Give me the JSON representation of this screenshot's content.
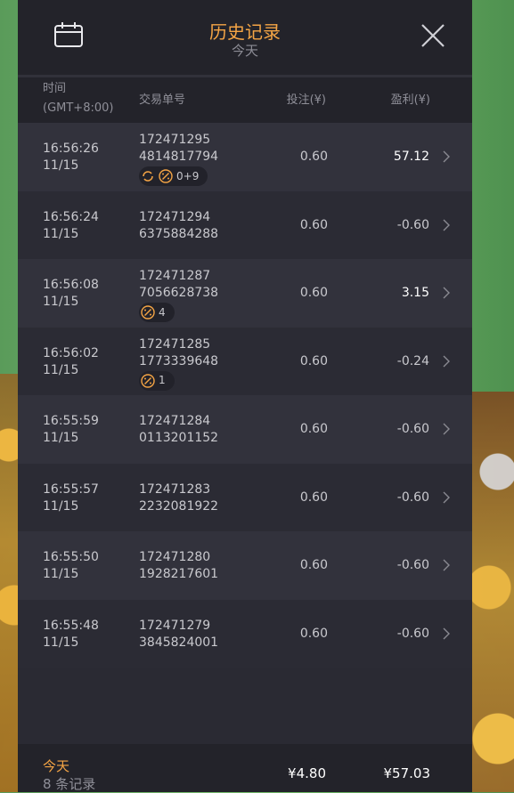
{
  "header": {
    "title": "历史记录",
    "subtitle": "今天"
  },
  "columns": {
    "time_line1": "时间",
    "time_line2": "(GMT+8:00)",
    "id": "交易单号",
    "bet": "投注(¥)",
    "profit": "盈利(¥)"
  },
  "rows": [
    {
      "time": "16:56:26",
      "date": "11/15",
      "id1": "172471295",
      "id2": "4814817794",
      "bet": "0.60",
      "profit": "57.12",
      "badge": "0+9",
      "badge_icons": [
        "spin-icon",
        "multiplier-icon"
      ]
    },
    {
      "time": "16:56:24",
      "date": "11/15",
      "id1": "172471294",
      "id2": "6375884288",
      "bet": "0.60",
      "profit": "-0.60"
    },
    {
      "time": "16:56:08",
      "date": "11/15",
      "id1": "172471287",
      "id2": "7056628738",
      "bet": "0.60",
      "profit": "3.15",
      "badge": "4",
      "badge_icons": [
        "multiplier-icon"
      ]
    },
    {
      "time": "16:56:02",
      "date": "11/15",
      "id1": "172471285",
      "id2": "1773339648",
      "bet": "0.60",
      "profit": "-0.24",
      "badge": "1",
      "badge_icons": [
        "multiplier-icon"
      ]
    },
    {
      "time": "16:55:59",
      "date": "11/15",
      "id1": "172471284",
      "id2": "0113201152",
      "bet": "0.60",
      "profit": "-0.60"
    },
    {
      "time": "16:55:57",
      "date": "11/15",
      "id1": "172471283",
      "id2": "2232081922",
      "bet": "0.60",
      "profit": "-0.60"
    },
    {
      "time": "16:55:50",
      "date": "11/15",
      "id1": "172471280",
      "id2": "1928217601",
      "bet": "0.60",
      "profit": "-0.60"
    },
    {
      "time": "16:55:48",
      "date": "11/15",
      "id1": "172471279",
      "id2": "3845824001",
      "bet": "0.60",
      "profit": "-0.60"
    }
  ],
  "footer": {
    "today": "今天",
    "count": "8 条记录",
    "total_bet": "¥4.80",
    "total_profit": "¥57.03"
  },
  "colors": {
    "accent": "#f5a545",
    "panel": "#2a2a33",
    "header": "#23232a"
  },
  "icons": {
    "header_left": "calendar-icon",
    "header_right": "close-icon",
    "row_right": "chevron-right-icon"
  }
}
